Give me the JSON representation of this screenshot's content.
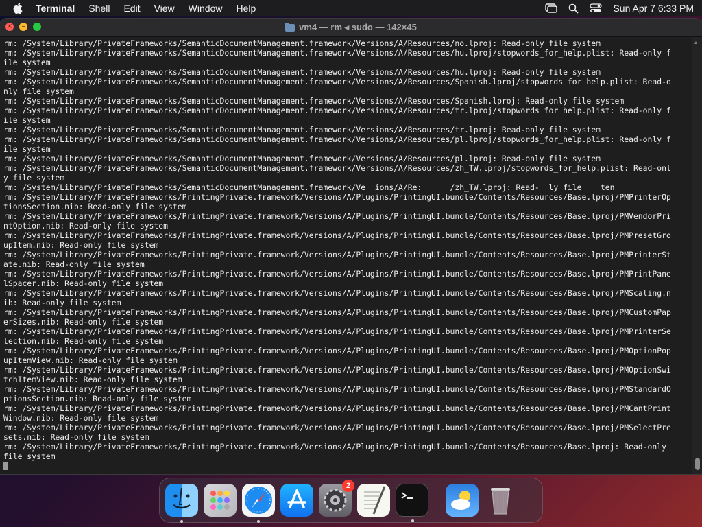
{
  "menubar": {
    "app_name": "Terminal",
    "items": [
      "Shell",
      "Edit",
      "View",
      "Window",
      "Help"
    ],
    "datetime": "Sun Apr 7  6:33 PM"
  },
  "window": {
    "title": "vm4 — rm ◂ sudo — 142×45",
    "lines": [
      "rm: /System/Library/PrivateFrameworks/SemanticDocumentManagement.framework/Versions/A/Resources/no.lproj: Read-only file system",
      "rm: /System/Library/PrivateFrameworks/SemanticDocumentManagement.framework/Versions/A/Resources/hu.lproj/stopwords_for_help.plist: Read-only f",
      "ile system",
      "rm: /System/Library/PrivateFrameworks/SemanticDocumentManagement.framework/Versions/A/Resources/hu.lproj: Read-only file system",
      "rm: /System/Library/PrivateFrameworks/SemanticDocumentManagement.framework/Versions/A/Resources/Spanish.lproj/stopwords_for_help.plist: Read-o",
      "nly file system",
      "rm: /System/Library/PrivateFrameworks/SemanticDocumentManagement.framework/Versions/A/Resources/Spanish.lproj: Read-only file system",
      "rm: /System/Library/PrivateFrameworks/SemanticDocumentManagement.framework/Versions/A/Resources/tr.lproj/stopwords_for_help.plist: Read-only f",
      "ile system",
      "rm: /System/Library/PrivateFrameworks/SemanticDocumentManagement.framework/Versions/A/Resources/tr.lproj: Read-only file system",
      "rm: /System/Library/PrivateFrameworks/SemanticDocumentManagement.framework/Versions/A/Resources/pl.lproj/stopwords_for_help.plist: Read-only f",
      "ile system",
      "rm: /System/Library/PrivateFrameworks/SemanticDocumentManagement.framework/Versions/A/Resources/pl.lproj: Read-only file system",
      "rm: /System/Library/PrivateFrameworks/SemanticDocumentManagement.framework/Versions/A/Resources/zh_TW.lproj/stopwords_for_help.plist: Read-onl",
      "y file system",
      "rm: /System/Library/PrivateFrameworks/SemanticDocumentManagement.framework/Ve  ions/A/Re:      /zh_TW.lproj: Read-  ly file    ten",
      "rm: /System/Library/PrivateFrameworks/PrintingPrivate.framework/Versions/A/Plugins/PrintingUI.bundle/Contents/Resources/Base.lproj/PMPrinterOp",
      "tionsSection.nib: Read-only file system",
      "rm: /System/Library/PrivateFrameworks/PrintingPrivate.framework/Versions/A/Plugins/PrintingUI.bundle/Contents/Resources/Base.lproj/PMVendorPri",
      "ntOption.nib: Read-only file system",
      "rm: /System/Library/PrivateFrameworks/PrintingPrivate.framework/Versions/A/Plugins/PrintingUI.bundle/Contents/Resources/Base.lproj/PMPresetGro",
      "upItem.nib: Read-only file system",
      "rm: /System/Library/PrivateFrameworks/PrintingPrivate.framework/Versions/A/Plugins/PrintingUI.bundle/Contents/Resources/Base.lproj/PMPrinterSt",
      "ate.nib: Read-only file system",
      "rm: /System/Library/PrivateFrameworks/PrintingPrivate.framework/Versions/A/Plugins/PrintingUI.bundle/Contents/Resources/Base.lproj/PMPrintPane",
      "lSpacer.nib: Read-only file system",
      "rm: /System/Library/PrivateFrameworks/PrintingPrivate.framework/Versions/A/Plugins/PrintingUI.bundle/Contents/Resources/Base.lproj/PMScaling.n",
      "ib: Read-only file system",
      "rm: /System/Library/PrivateFrameworks/PrintingPrivate.framework/Versions/A/Plugins/PrintingUI.bundle/Contents/Resources/Base.lproj/PMCustomPap",
      "erSizes.nib: Read-only file system",
      "rm: /System/Library/PrivateFrameworks/PrintingPrivate.framework/Versions/A/Plugins/PrintingUI.bundle/Contents/Resources/Base.lproj/PMPrinterSe",
      "lection.nib: Read-only file system",
      "rm: /System/Library/PrivateFrameworks/PrintingPrivate.framework/Versions/A/Plugins/PrintingUI.bundle/Contents/Resources/Base.lproj/PMOptionPop",
      "upItemView.nib: Read-only file system",
      "rm: /System/Library/PrivateFrameworks/PrintingPrivate.framework/Versions/A/Plugins/PrintingUI.bundle/Contents/Resources/Base.lproj/PMOptionSwi",
      "tchItemView.nib: Read-only file system",
      "rm: /System/Library/PrivateFrameworks/PrintingPrivate.framework/Versions/A/Plugins/PrintingUI.bundle/Contents/Resources/Base.lproj/PMStandardO",
      "ptionsSection.nib: Read-only file system",
      "rm: /System/Library/PrivateFrameworks/PrintingPrivate.framework/Versions/A/Plugins/PrintingUI.bundle/Contents/Resources/Base.lproj/PMCantPrint",
      "Window.nib: Read-only file system",
      "rm: /System/Library/PrivateFrameworks/PrintingPrivate.framework/Versions/A/Plugins/PrintingUI.bundle/Contents/Resources/Base.lproj/PMSelectPre",
      "sets.nib: Read-only file system",
      "rm: /System/Library/PrivateFrameworks/PrintingPrivate.framework/Versions/A/Plugins/PrintingUI.bundle/Contents/Resources/Base.lproj: Read-only",
      "file system"
    ]
  },
  "dock": {
    "items": [
      {
        "name": "finder",
        "icon": "finder-icon",
        "running": true
      },
      {
        "name": "launchpad",
        "icon": "launchpad-icon",
        "running": false
      },
      {
        "name": "safari",
        "icon": "safari-icon",
        "running": true
      },
      {
        "name": "app-store",
        "icon": "app-store-icon",
        "running": false
      },
      {
        "name": "system-settings",
        "icon": "gear-icon",
        "running": false,
        "badge": "2"
      },
      {
        "name": "textedit",
        "icon": "textedit-icon",
        "running": false
      },
      {
        "name": "terminal",
        "icon": "terminal-icon",
        "running": true
      },
      {
        "name": "weather",
        "icon": "weather-icon",
        "running": false
      },
      {
        "name": "trash",
        "icon": "trash-icon",
        "running": false
      }
    ]
  }
}
